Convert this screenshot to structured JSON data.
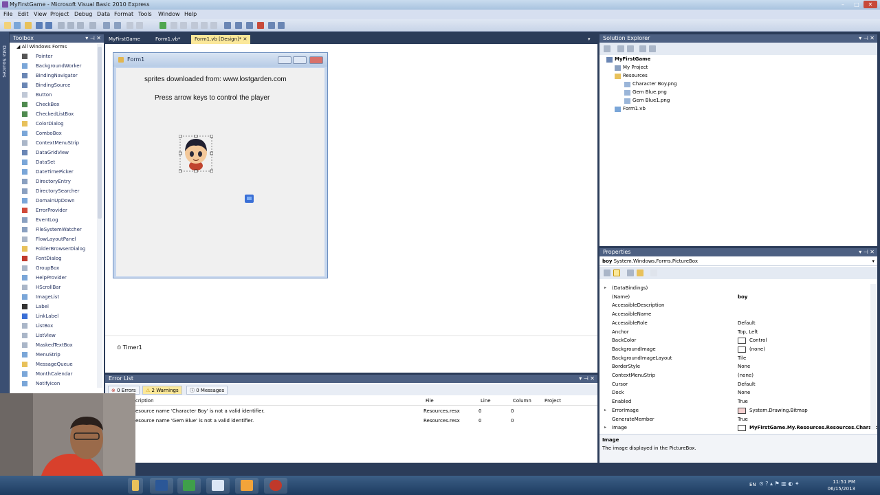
{
  "window": {
    "title": "MyFirstGame - Microsoft Visual Basic 2010 Express",
    "controls": [
      "–",
      "□",
      "✕"
    ]
  },
  "menu": [
    "File",
    "Edit",
    "View",
    "Project",
    "Debug",
    "Data",
    "Format",
    "Tools",
    "Window",
    "Help"
  ],
  "left_strip": {
    "label": "Data Sources"
  },
  "toolbox": {
    "title": "Toolbox",
    "group": "All Windows Forms",
    "items": [
      "Pointer",
      "BackgroundWorker",
      "BindingNavigator",
      "BindingSource",
      "Button",
      "CheckBox",
      "CheckedListBox",
      "ColorDialog",
      "ComboBox",
      "ContextMenuStrip",
      "DataGridView",
      "DataSet",
      "DateTimePicker",
      "DirectoryEntry",
      "DirectorySearcher",
      "DomainUpDown",
      "ErrorProvider",
      "EventLog",
      "FileSystemWatcher",
      "FlowLayoutPanel",
      "FolderBrowserDialog",
      "FontDialog",
      "GroupBox",
      "HelpProvider",
      "HScrollBar",
      "ImageList",
      "Label",
      "LinkLabel",
      "ListBox",
      "ListView",
      "MaskedTextBox",
      "MenuStrip",
      "MessageQueue",
      "MonthCalendar",
      "NotifyIcon"
    ]
  },
  "doc_tabs": [
    {
      "label": "MyFirstGame",
      "active": false
    },
    {
      "label": "Form1.vb*",
      "active": false
    },
    {
      "label": "Form1.vb [Design]*",
      "active": true
    }
  ],
  "form": {
    "title": "Form1",
    "label1": "sprites downloaded from: www.lostgarden.com",
    "label2": "Press arrow keys to control the player"
  },
  "tray": {
    "component": "Timer1"
  },
  "error_list": {
    "title": "Error List",
    "tabs": [
      "0 Errors",
      "2 Warnings",
      "0 Messages"
    ],
    "columns": {
      "description": "cription",
      "file": "File",
      "line": "Line",
      "column": "Column",
      "project": "Project"
    },
    "rows": [
      {
        "description": "esource name 'Character Boy' is not a valid identifier.",
        "file": "Resources.resx",
        "line": "0",
        "column": "0"
      },
      {
        "description": "esource name 'Gem Blue' is not a valid identifier.",
        "file": "Resources.resx",
        "line": "0",
        "column": "0"
      }
    ]
  },
  "solution_explorer": {
    "title": "Solution Explorer",
    "project": "MyFirstGame",
    "my_project": "My Project",
    "resources": "Resources",
    "resource_files": [
      "Character Boy.png",
      "Gem Blue.png",
      "Gem Blue1.png"
    ],
    "form_file": "Form1.vb"
  },
  "properties": {
    "title": "Properties",
    "object_name": "boy",
    "object_type": "System.Windows.Forms.PictureBox",
    "rows": [
      {
        "name": "(DataBindings)",
        "value": "",
        "expand": true
      },
      {
        "name": "(Name)",
        "value": "boy",
        "bold": true
      },
      {
        "name": "AccessibleDescription",
        "value": ""
      },
      {
        "name": "AccessibleName",
        "value": ""
      },
      {
        "name": "AccessibleRole",
        "value": "Default"
      },
      {
        "name": "Anchor",
        "value": "Top, Left"
      },
      {
        "name": "BackColor",
        "value": "Control",
        "swatch": true
      },
      {
        "name": "BackgroundImage",
        "value": "(none)",
        "swatch": true
      },
      {
        "name": "BackgroundImageLayout",
        "value": "Tile"
      },
      {
        "name": "BorderStyle",
        "value": "None"
      },
      {
        "name": "ContextMenuStrip",
        "value": "(none)"
      },
      {
        "name": "Cursor",
        "value": "Default"
      },
      {
        "name": "Dock",
        "value": "None"
      },
      {
        "name": "Enabled",
        "value": "True"
      },
      {
        "name": "ErrorImage",
        "value": "System.Drawing.Bitmap",
        "expand": true,
        "swatch": true
      },
      {
        "name": "GenerateMember",
        "value": "True"
      },
      {
        "name": "Image",
        "value": "MyFirstGame.My.Resources.Resources.Charact",
        "expand": true,
        "swatch": true,
        "bold": true
      }
    ],
    "description_title": "Image",
    "description_text": "The image displayed in the PictureBox."
  },
  "taskbar": {
    "time": "11:51 PM",
    "date": "06/15/2013",
    "language": "EN"
  }
}
